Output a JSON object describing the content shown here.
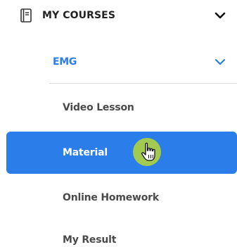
{
  "menu": {
    "section_label": "MY COURSES",
    "course_label": "EMG",
    "items": [
      {
        "label": "Video Lesson"
      },
      {
        "label": "Material"
      },
      {
        "label": "Online Homework"
      },
      {
        "label": "My Result"
      }
    ],
    "active_index": 1
  },
  "icons": {
    "section": "book-icon",
    "section_chevron": "chevron-down-icon",
    "course_chevron": "chevron-down-icon",
    "cursor": "hand-pointer-icon"
  },
  "colors": {
    "accent": "#2b7de9",
    "cursor_halo": "#a9cf48",
    "text_primary": "#222222",
    "text_secondary": "#4a4a4a"
  }
}
